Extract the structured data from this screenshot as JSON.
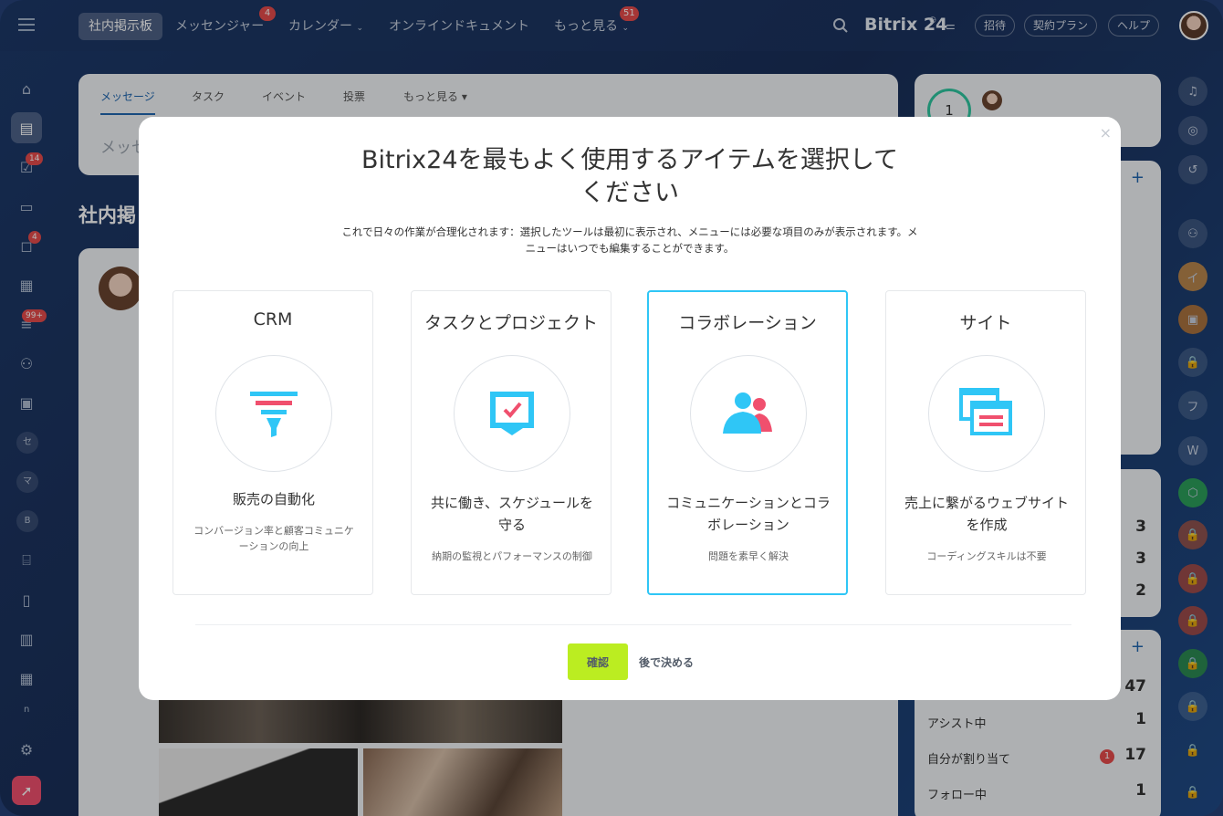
{
  "topbar": {
    "tabs": [
      {
        "label": "社内掲示板"
      },
      {
        "label": "メッセンジャー",
        "badge": "4"
      },
      {
        "label": "カレンダー"
      },
      {
        "label": "オンラインドキュメント"
      },
      {
        "label": "もっと見る",
        "badge": "51"
      }
    ],
    "brand": "Bitrix 24",
    "buttons": {
      "invite": "招待",
      "plan": "契約プラン",
      "help": "ヘルプ"
    }
  },
  "sidebar": {
    "badges": {
      "tasks": "14",
      "chat": "4",
      "feed": "99+"
    },
    "letters": [
      "セ",
      "マ",
      "B",
      "n"
    ]
  },
  "feed": {
    "tabs": [
      "メッセージ",
      "タスク",
      "イベント",
      "投票",
      "もっと見る"
    ],
    "input_placeholder": "メッセ",
    "section_title": "社内掲"
  },
  "right": {
    "counter": "1",
    "stats": [
      {
        "value": "3"
      },
      {
        "value": "3"
      },
      {
        "value": "2"
      },
      {
        "value": "47"
      },
      {
        "label": "アシスト中",
        "value": "1"
      },
      {
        "label": "自分が割り当て",
        "value": "17",
        "badge": "1"
      },
      {
        "label": "フォロー中",
        "value": "1"
      }
    ],
    "rail_letters": [
      "イ",
      "フ",
      "W"
    ]
  },
  "modal": {
    "title_line1": "Bitrix24を最もよく使用するアイテムを選択して",
    "title_line2": "ください",
    "subtitle": "これで日々の作業が合理化されます：選択したツールは最初に表示され、メニューには必要な項目のみが表示されます。メニューはいつでも編集することができます。",
    "cards": [
      {
        "title": "CRM",
        "head": "販売の自動化",
        "desc": "コンバージョン率と顧客コミュニケーションの向上",
        "icon": "funnel-icon"
      },
      {
        "title": "タスクとプロジェクト",
        "head": "共に働き、スケジュールを守る",
        "desc": "納期の監視とパフォーマンスの制御",
        "icon": "task-check-icon"
      },
      {
        "title": "コラボレーション",
        "head": "コミュニケーションとコラボレーション",
        "desc": "問題を素早く解決",
        "icon": "users-icon"
      },
      {
        "title": "サイト",
        "head": "売上に繋がるウェブサイトを作成",
        "desc": "コーディングスキルは不要",
        "icon": "site-windows-icon"
      }
    ],
    "confirm_label": "確認",
    "later_label": "後で決める",
    "close_symbol": "×"
  },
  "colors": {
    "accent_green": "#bbed21",
    "accent_blue": "#2fc6f6",
    "accent_red": "#f0506e"
  }
}
